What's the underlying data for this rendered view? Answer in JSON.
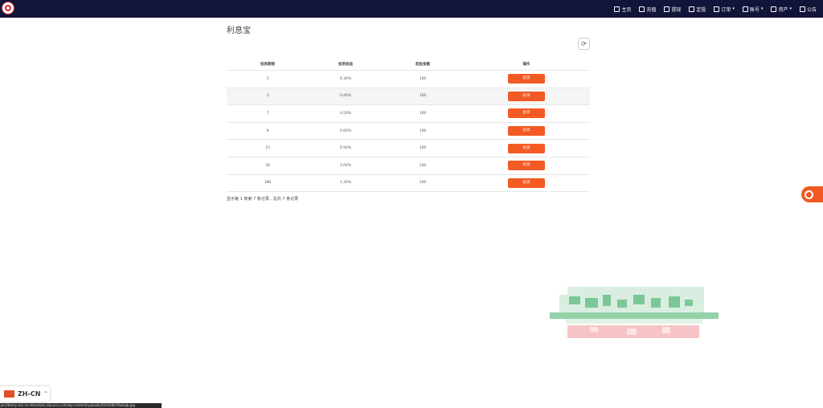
{
  "nav": {
    "items": [
      {
        "label": "主页",
        "icon": "home-icon"
      },
      {
        "label": "充值",
        "icon": "gear-icon"
      },
      {
        "label": "提现",
        "icon": "withdraw-icon"
      },
      {
        "label": "定投",
        "icon": "invest-icon"
      },
      {
        "label": "订单",
        "icon": "order-icon",
        "caret": "▾"
      },
      {
        "label": "账号",
        "icon": "user-icon",
        "caret": "▾"
      },
      {
        "label": "资产",
        "icon": "asset-icon",
        "caret": "▾"
      },
      {
        "label": "公告",
        "icon": "notice-icon"
      }
    ]
  },
  "page": {
    "title": "利息宝",
    "refresh_icon": "⟳"
  },
  "table": {
    "headers": [
      "投资期限",
      "投资收益",
      "起投金额",
      "操作"
    ],
    "rows": [
      {
        "term": "1",
        "rate": "0.30%",
        "min": "100",
        "action": "投资"
      },
      {
        "term": "3",
        "rate": "0.40%",
        "min": "100",
        "action": "投资"
      },
      {
        "term": "7",
        "rate": "0.50%",
        "min": "100",
        "action": "投资"
      },
      {
        "term": "9",
        "rate": "0.60%",
        "min": "100",
        "action": "投资"
      },
      {
        "term": "15",
        "rate": "0.90%",
        "min": "100",
        "action": "投资"
      },
      {
        "term": "30",
        "rate": "1.00%",
        "min": "100",
        "action": "投资"
      },
      {
        "term": "180",
        "rate": "1.20%",
        "min": "100",
        "action": "投资"
      }
    ]
  },
  "pagination": {
    "text": "显示第 1 到第 7 条记录，总共 7 条记录"
  },
  "language": {
    "label": "ZH-CN",
    "caret": "^"
  },
  "status_bar": {
    "url": "ps://tenny-oss-cn-shenzhen.aliyuncs.com/wp-content/uploads/2024/08/1RwGqb.jpg"
  },
  "colors": {
    "navbar": "#12143a",
    "accent": "#f45a24",
    "support": "#f15a22"
  }
}
